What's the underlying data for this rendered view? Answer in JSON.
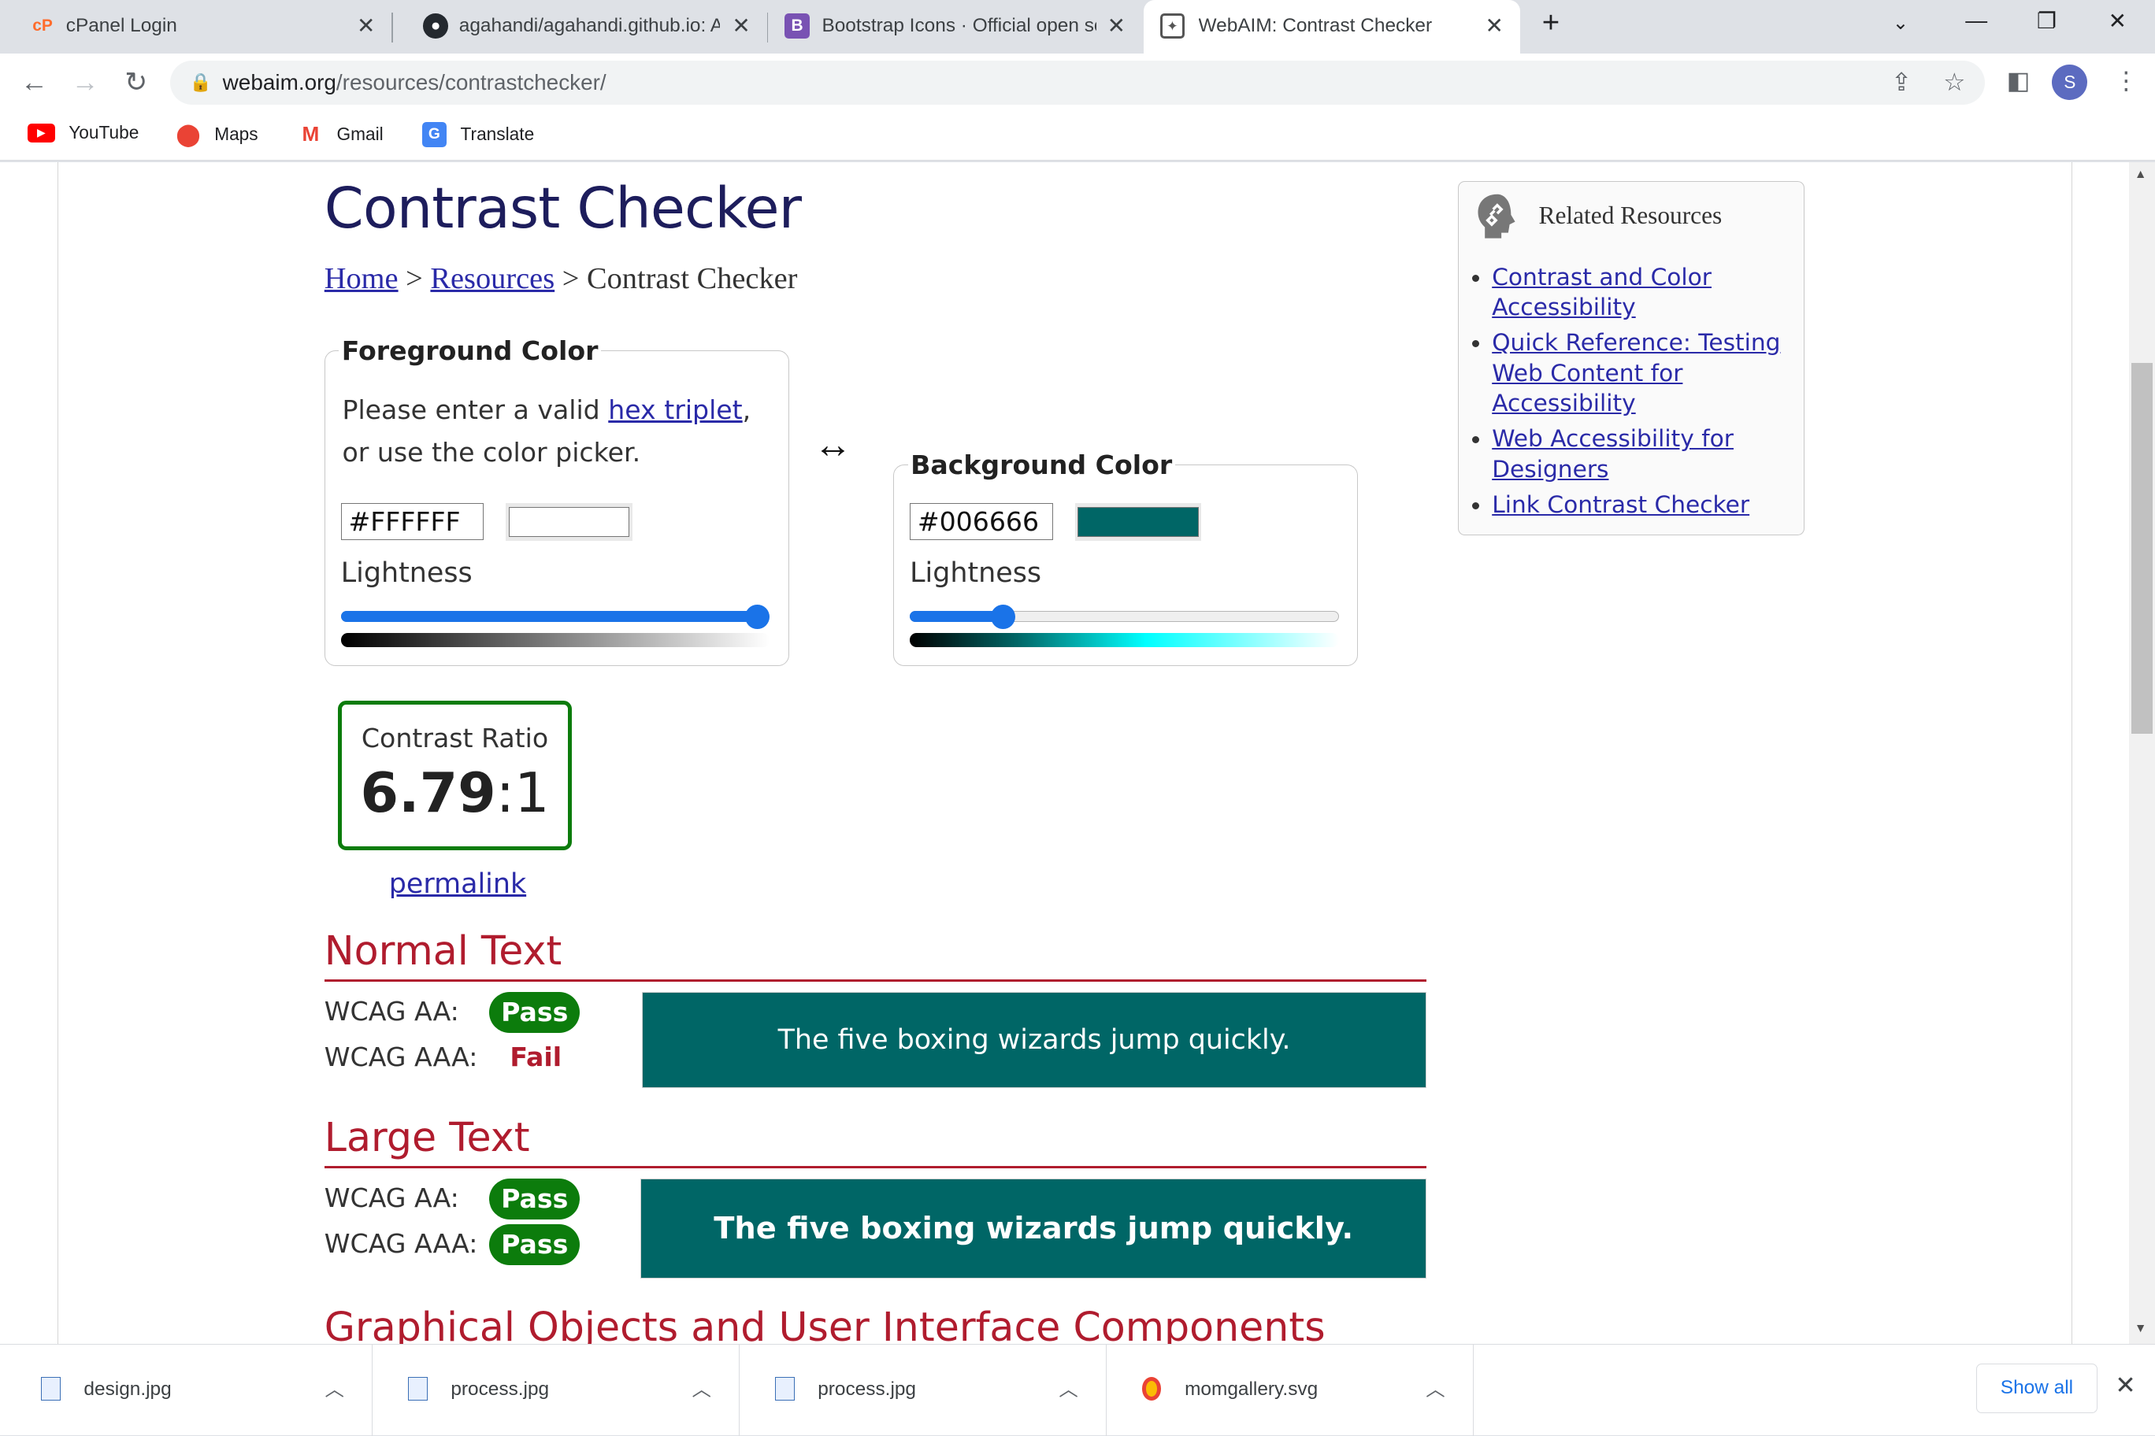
{
  "browser": {
    "tabs": [
      {
        "title": "cPanel Login",
        "icon": "cpanel-icon",
        "color": "#ff6c2c"
      },
      {
        "title": "agahandi/agahandi.github.io: A p",
        "icon": "github-icon",
        "color": "#24292f"
      },
      {
        "title": "Bootstrap Icons · Official open so",
        "icon": "bootstrap-icon",
        "color": "#7952b3"
      },
      {
        "title": "WebAIM: Contrast Checker",
        "icon": "webaim-icon",
        "color": "#555555"
      }
    ],
    "new_tab": "+",
    "url_host": "webaim.org",
    "url_path": "/resources/contrastchecker/",
    "profile_initial": "S",
    "bookmarks": [
      "YouTube",
      "Maps",
      "Gmail",
      "Translate"
    ]
  },
  "page": {
    "title": "Contrast Checker",
    "breadcrumb": {
      "home": "Home",
      "resources": "Resources",
      "current": "Contrast Checker",
      "sep": ">"
    },
    "foreground": {
      "legend": "Foreground Color",
      "instr_before": "Please enter a valid ",
      "instr_link": "hex triplet",
      "instr_after": ",",
      "instr_line2": "or use the color picker.",
      "hex": "#FFFFFF",
      "swatch_color": "#ffffff",
      "lightness_label": "Lightness",
      "lightness": 1.0
    },
    "swap_icon": "↔",
    "background": {
      "legend": "Background Color",
      "hex": "#006666",
      "swatch_color": "#006666",
      "lightness_label": "Lightness",
      "lightness": 0.2
    },
    "contrast": {
      "label": "Contrast Ratio",
      "value": "6.79",
      "suffix": ":1"
    },
    "permalink": "permalink",
    "normal_text": {
      "heading": "Normal Text",
      "aa_label": "WCAG AA:",
      "aa_result": "Pass",
      "aaa_label": "WCAG AAA:",
      "aaa_result": "Fail",
      "sample": "The five boxing wizards jump quickly."
    },
    "large_text": {
      "heading": "Large Text",
      "aa_label": "WCAG AA:",
      "aa_result": "Pass",
      "aaa_label": "WCAG AAA:",
      "aaa_result": "Pass",
      "sample": "The five boxing wizards jump quickly."
    },
    "graphical_heading": "Graphical Objects and User Interface Components",
    "related": {
      "heading": "Related Resources",
      "links": [
        "Contrast and Color Accessibility",
        "Quick Reference: Testing Web Content for Accessibility",
        "Web Accessibility for Designers",
        "Link Contrast Checker"
      ]
    }
  },
  "downloads": {
    "items": [
      "design.jpg",
      "process.jpg",
      "process.jpg",
      "momgallery.svg"
    ],
    "show_all": "Show all"
  },
  "colors": {
    "accent": "#1a73e8",
    "pass": "#0c7c0c",
    "fail": "#b01c2e",
    "sample_bg": "#006666"
  }
}
